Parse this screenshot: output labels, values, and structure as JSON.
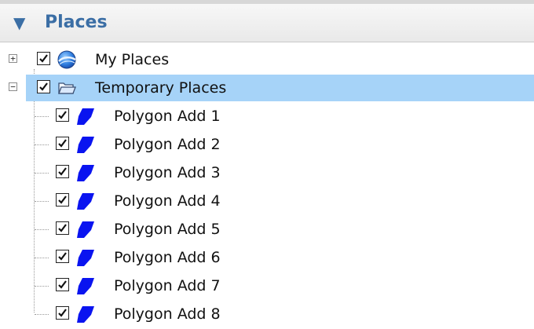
{
  "panel": {
    "title": "Places",
    "collapse_glyph": "▼"
  },
  "tree": {
    "root_items": [
      {
        "label": "My Places",
        "checked": true,
        "expanded": false,
        "expander_glyph": "+",
        "icon": "globe-icon"
      },
      {
        "label": "Temporary Places",
        "checked": true,
        "expanded": true,
        "selected": true,
        "expander_glyph": "−",
        "icon": "folder-icon"
      }
    ],
    "children": [
      {
        "label": "Polygon Add 1",
        "checked": true,
        "icon": "polygon-icon"
      },
      {
        "label": "Polygon Add 2",
        "checked": true,
        "icon": "polygon-icon"
      },
      {
        "label": "Polygon Add 3",
        "checked": true,
        "icon": "polygon-icon"
      },
      {
        "label": "Polygon Add 4",
        "checked": true,
        "icon": "polygon-icon"
      },
      {
        "label": "Polygon Add 5",
        "checked": true,
        "icon": "polygon-icon"
      },
      {
        "label": "Polygon Add 6",
        "checked": true,
        "icon": "polygon-icon"
      },
      {
        "label": "Polygon Add 7",
        "checked": true,
        "icon": "polygon-icon"
      },
      {
        "label": "Polygon Add 8",
        "checked": true,
        "icon": "polygon-icon"
      }
    ]
  },
  "colors": {
    "header_text": "#3b6ea5",
    "selection": "#a6d3f8",
    "polygon_fill": "#0a14f0"
  }
}
